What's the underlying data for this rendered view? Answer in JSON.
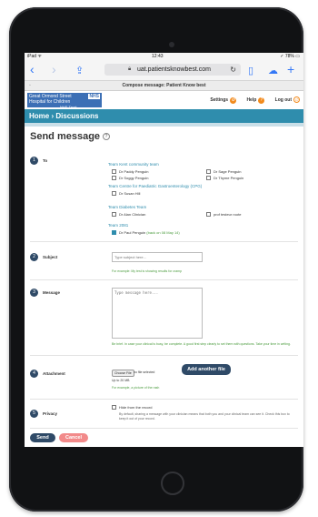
{
  "status": {
    "carrier": "iPad ᯤ",
    "time": "12:43",
    "battery": "✓ 78% ▭"
  },
  "browser": {
    "url": "uat.patientsknowbest.com",
    "tab_title": "Compose message: Patient Know best"
  },
  "site": {
    "logo_line1": "Great Ormond Street",
    "logo_line2": "Hospital for Children",
    "logo_line3": "NHS Trust",
    "logo_nhs": "NHS",
    "settings": "Settings",
    "help": "Help",
    "logout": "Log out",
    "breadcrumb": "Home  ›  Discussions"
  },
  "page": {
    "title": "Send message",
    "help_glyph": "?"
  },
  "to": {
    "step": "1",
    "label": "To",
    "groups": [
      {
        "name": "Team Kent community team"
      },
      {
        "name": "Team Centre for Paediatric Gastroenterology (CPG)"
      },
      {
        "name": "Team Diabetes Team"
      },
      {
        "name": "Team 2081"
      }
    ],
    "members": {
      "paddy": "Dr Paddy Penguin",
      "sage": "Dr Sage Penguin",
      "soggy": "Dr Soggy Penguin",
      "thyme": "Dr Thyme Penguin",
      "susan": "Dr Susan Hill",
      "alan": "Dr Alan Clinician",
      "prof": "prof testeur roote",
      "paul": "Dr Paul Penguin",
      "paul_note": "(back on 08 May 14)"
    }
  },
  "subject": {
    "step": "2",
    "label": "Subject",
    "placeholder": "Type subject here...",
    "hint": "For example: My test is showing results for cramp"
  },
  "message": {
    "step": "3",
    "label": "Message",
    "placeholder": "Type message here...",
    "hint": "Be brief. In case your clinical is busy, be complete. A good first step clearly to set them with questions. Take your time in writing."
  },
  "attachment": {
    "step": "4",
    "label": "Attachment",
    "choose": "Choose File",
    "no_file": "no file selected",
    "limit": "Up to 20 MB",
    "hint": "For example, a picture of the rash",
    "add_button": "Add another file"
  },
  "privacy": {
    "step": "5",
    "label": "Privacy",
    "option": "Hide from the record",
    "desc": "By default, sharing a message with your clinician means that both you and your clinical team can see it. Check this box to keep it out of your record."
  },
  "actions": {
    "send": "Send",
    "cancel": "Cancel"
  }
}
